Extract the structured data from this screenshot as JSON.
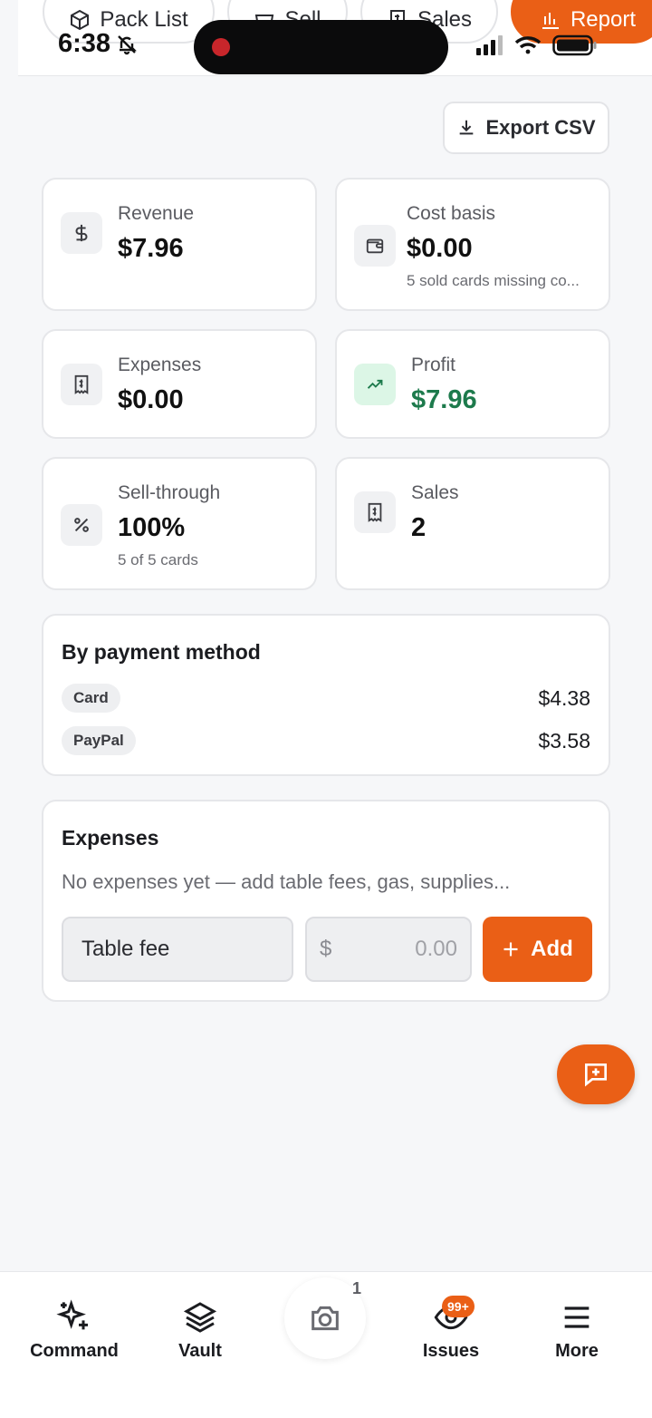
{
  "status_bar": {
    "time": "6:38"
  },
  "top_tabs": [
    {
      "label": "Pack List",
      "icon": "box-icon"
    },
    {
      "label": "Sell",
      "icon": "basket-icon"
    },
    {
      "label": "Sales",
      "icon": "receipt-icon"
    },
    {
      "label": "Report",
      "icon": "bar-chart-icon",
      "active": true
    }
  ],
  "export_label": "Export CSV",
  "stats": {
    "revenue": {
      "label": "Revenue",
      "value": "$7.96",
      "icon": "dollar-icon"
    },
    "cost_basis": {
      "label": "Cost basis",
      "value": "$0.00",
      "sub": "5 sold cards missing co...",
      "icon": "wallet-icon"
    },
    "expenses": {
      "label": "Expenses",
      "value": "$0.00",
      "icon": "receipt-icon"
    },
    "profit": {
      "label": "Profit",
      "value": "$7.96",
      "icon": "trend-up-icon"
    },
    "sell_through": {
      "label": "Sell-through",
      "value": "100%",
      "sub": "5 of 5 cards",
      "icon": "percent-icon"
    },
    "sales": {
      "label": "Sales",
      "value": "2",
      "icon": "receipt-icon"
    }
  },
  "payment": {
    "title": "By payment method",
    "methods": [
      {
        "name": "Card",
        "amount": "$4.38"
      },
      {
        "name": "PayPal",
        "amount": "$3.58"
      }
    ]
  },
  "expenses_section": {
    "title": "Expenses",
    "empty_text": "No expenses yet — add table fees, gas, supplies...",
    "name_value": "Table fee",
    "currency": "$",
    "amount_placeholder": "0.00",
    "add_label": "Add"
  },
  "bottom_nav": {
    "command": "Command",
    "vault": "Vault",
    "camera_count": "1",
    "issues": "Issues",
    "issues_badge": "99+",
    "more": "More"
  },
  "colors": {
    "accent": "#ea5f16",
    "profit_green": "#1d7a4c"
  }
}
